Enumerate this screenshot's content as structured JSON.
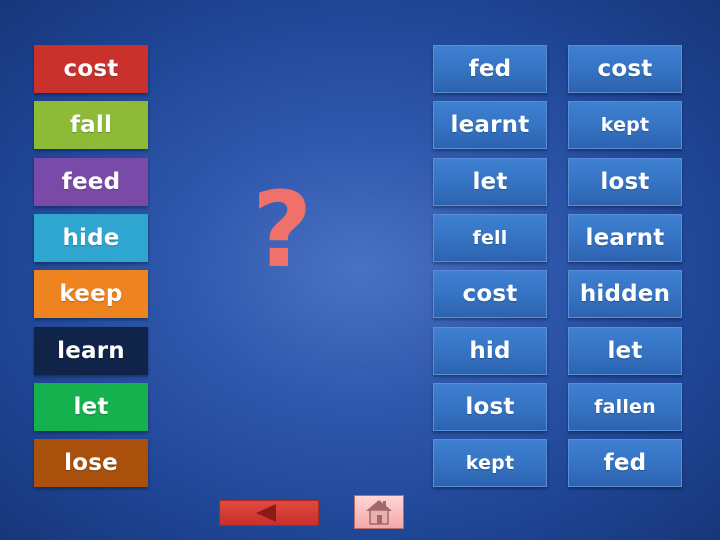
{
  "left_words": [
    {
      "label": "cost",
      "color": "#c9322c"
    },
    {
      "label": "fall",
      "color": "#8dbb38"
    },
    {
      "label": "feed",
      "color": "#7a4aa8"
    },
    {
      "label": "hide",
      "color": "#2fa6cf"
    },
    {
      "label": "keep",
      "color": "#ee8420"
    },
    {
      "label": "learn",
      "color": "#102449"
    },
    {
      "label": "let",
      "color": "#14b14e"
    },
    {
      "label": "lose",
      "color": "#a8500c"
    }
  ],
  "answers_col1": [
    "fed",
    "learnt",
    "let",
    "fell",
    "cost",
    "hid",
    "lost",
    "kept"
  ],
  "answers_col2": [
    "cost",
    "kept",
    "lost",
    "learnt",
    "hidden",
    "let",
    "fallen",
    "fed"
  ],
  "question_mark": "?",
  "question_color": "#f0706a",
  "nav": {
    "back_icon": "left-triangle-icon",
    "home_icon": "home-icon"
  }
}
